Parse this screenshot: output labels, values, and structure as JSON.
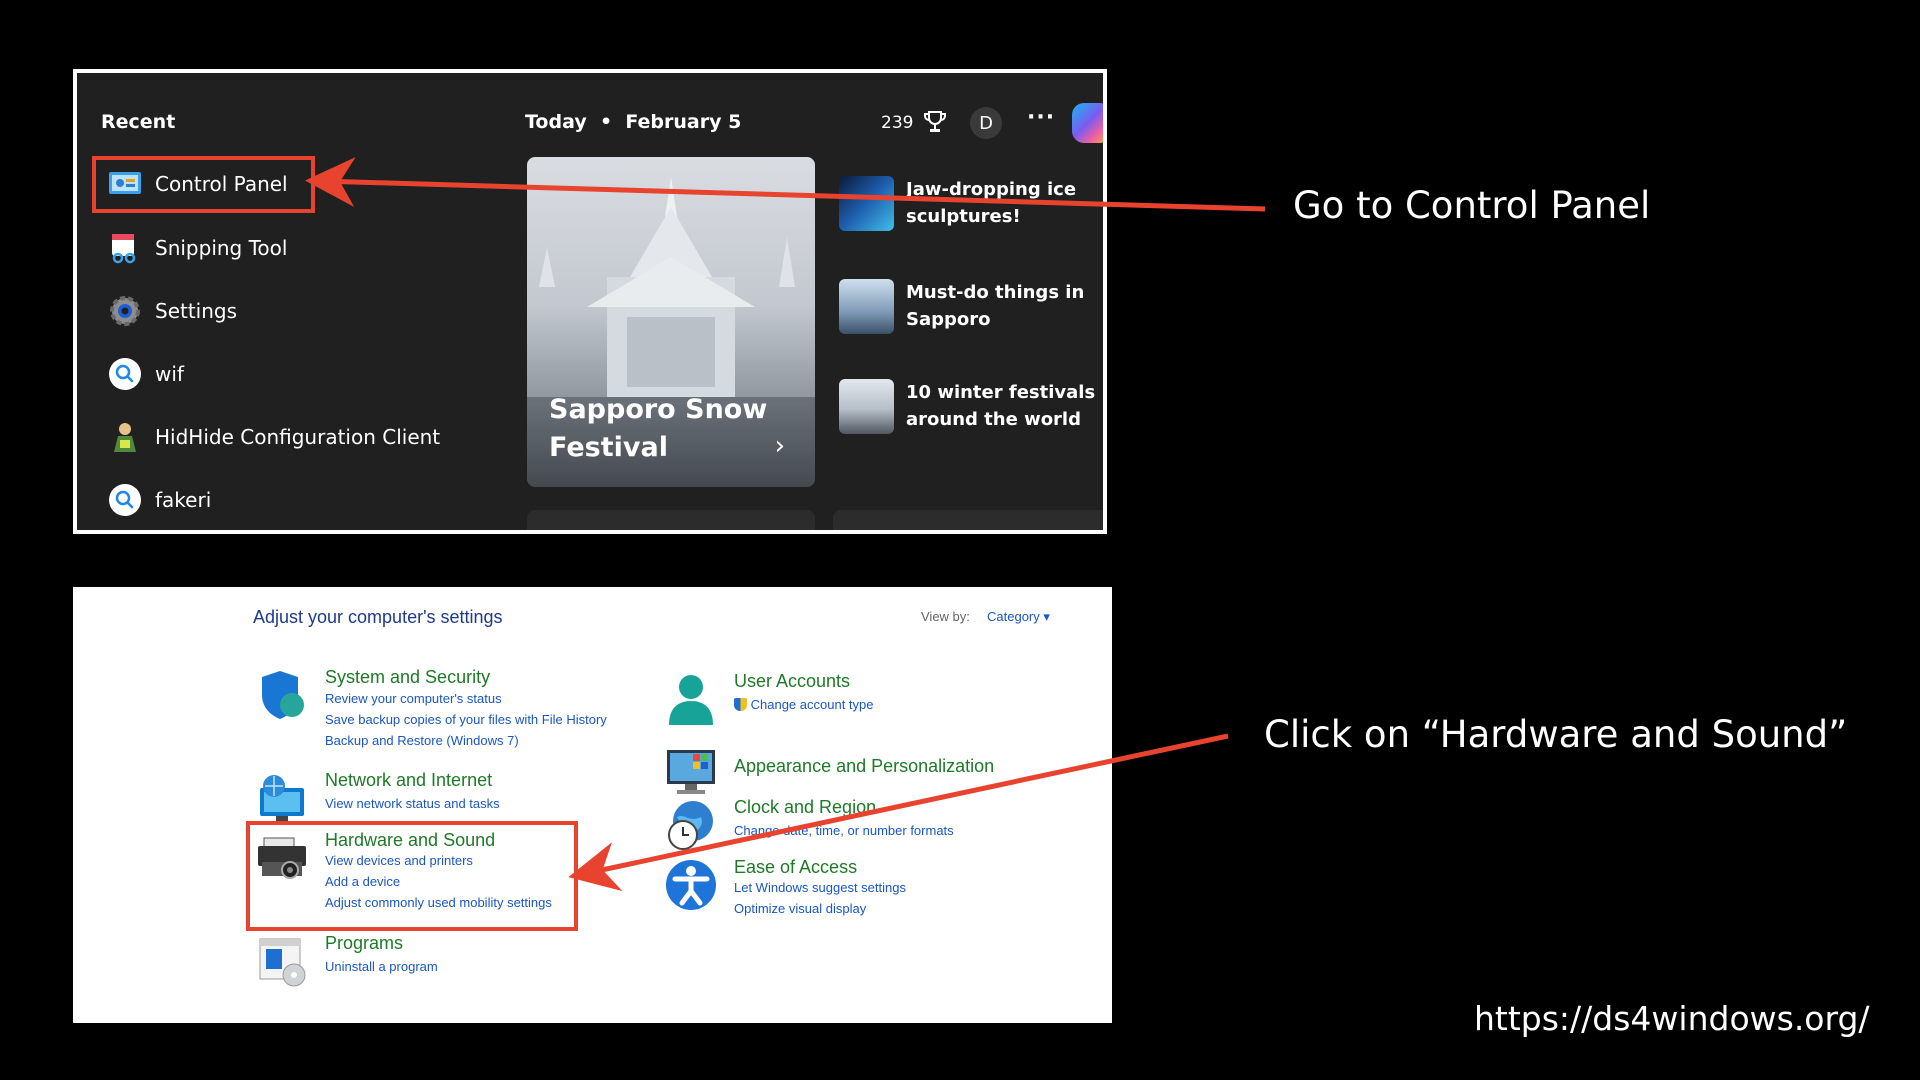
{
  "start_menu": {
    "recent_title": "Recent",
    "recent_items": [
      {
        "label": "Control Panel",
        "icon": "control-panel-icon"
      },
      {
        "label": "Snipping Tool",
        "icon": "snipping-tool-icon"
      },
      {
        "label": "Settings",
        "icon": "settings-gear-icon"
      },
      {
        "label": "wif",
        "icon": "search-icon"
      },
      {
        "label": "HidHide Configuration Client",
        "icon": "hidhide-icon"
      },
      {
        "label": "fakeri",
        "icon": "search-icon"
      }
    ],
    "date_header": "Today  •  February 5",
    "points": "239",
    "avatar_initial": "D",
    "more": "···",
    "hero": {
      "title_line1": "Sapporo Snow",
      "title_line2": "Festival"
    },
    "news": [
      {
        "line1": "Jaw-dropping ice",
        "line2": "sculptures!"
      },
      {
        "line1": "Must-do things in",
        "line2": "Sapporo"
      },
      {
        "line1": "10 winter festivals",
        "line2": "around the world"
      }
    ]
  },
  "control_panel": {
    "heading": "Adjust your computer's settings",
    "view_by_label": "View by:",
    "view_by_value": "Category",
    "left_categories": [
      {
        "title": "System and Security",
        "links": [
          "Review your computer's status",
          "Save backup copies of your files with File History",
          "Backup and Restore (Windows 7)"
        ],
        "icon": "shield-icon"
      },
      {
        "title": "Network and Internet",
        "links": [
          "View network status and tasks"
        ],
        "icon": "network-icon"
      },
      {
        "title": "Hardware and Sound",
        "links": [
          "View devices and printers",
          "Add a device",
          "Adjust commonly used mobility settings"
        ],
        "icon": "printer-icon"
      },
      {
        "title": "Programs",
        "links": [
          "Uninstall a program"
        ],
        "icon": "programs-icon"
      }
    ],
    "right_categories": [
      {
        "title": "User Accounts",
        "links": [
          "Change account type"
        ],
        "icon": "user-icon"
      },
      {
        "title": "Appearance and Personalization",
        "links": [],
        "icon": "monitor-icon"
      },
      {
        "title": "Clock and Region",
        "links": [
          "Change date, time, or number formats"
        ],
        "icon": "clock-globe-icon"
      },
      {
        "title": "Ease of Access",
        "links": [
          "Let Windows suggest settings",
          "Optimize visual display"
        ],
        "icon": "accessibility-icon"
      }
    ]
  },
  "annotations": {
    "step1": "Go to Control Panel",
    "step2": "Click on “Hardware and Sound”",
    "url": "https://ds4windows.org/"
  },
  "colors": {
    "highlight": "#e8432f",
    "cp_link": "#1a56c4",
    "cp_title": "#1e7a27"
  }
}
